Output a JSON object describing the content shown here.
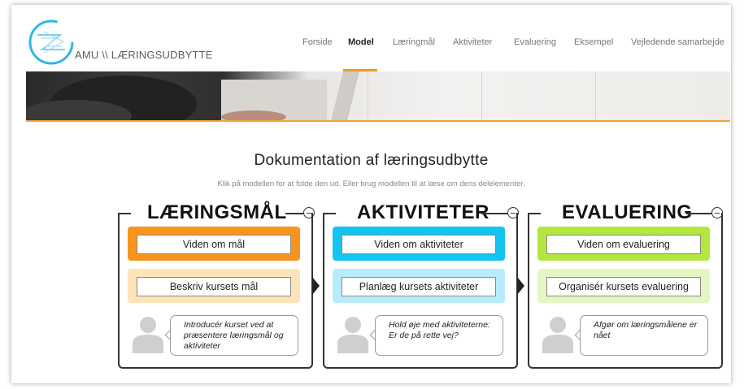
{
  "header": {
    "logo_text": "AMU \\\\ LÆRINGSUDBYTTE",
    "nav": [
      {
        "label": "Forside",
        "active": false
      },
      {
        "label": "Model",
        "active": true
      },
      {
        "label": "Læringmål",
        "active": false
      },
      {
        "label": "Aktiviteter",
        "active": false
      },
      {
        "label": "Evaluering",
        "active": false
      },
      {
        "label": "Eksempel",
        "active": false
      },
      {
        "label": "Vejledende samarbejde",
        "active": false
      }
    ]
  },
  "main": {
    "title": "Dokumentation af læringsudbytte",
    "subtitle": "Klik på modellen for at folde den ud. Eller brug modellen til at læse om dens delelementer."
  },
  "model": {
    "panels": [
      {
        "title": "LÆRINGSMÅL",
        "box1": "Viden om mål",
        "box2": "Beskriv kursets mål",
        "bubble": "Introducér kurset ved at præsentere læringsmål og aktiviteter",
        "color": "#f7941d",
        "light_color": "#fde3b8"
      },
      {
        "title": "AKTIVITETER",
        "box1": "Viden om aktiviteter",
        "box2": "Planlæg kursets aktiviteter",
        "bubble": "Hold øje med aktiviteterne: Er de på rette vej?",
        "color": "#13c4f0",
        "light_color": "#b9ecfa"
      },
      {
        "title": "EVALUERING",
        "box1": "Viden om evaluering",
        "box2": "Organisér kursets evaluering",
        "bubble": "Afgør om læringsmålene er nået",
        "color": "#b5e640",
        "light_color": "#e6f5c4"
      }
    ],
    "collapse_symbol": "−"
  }
}
